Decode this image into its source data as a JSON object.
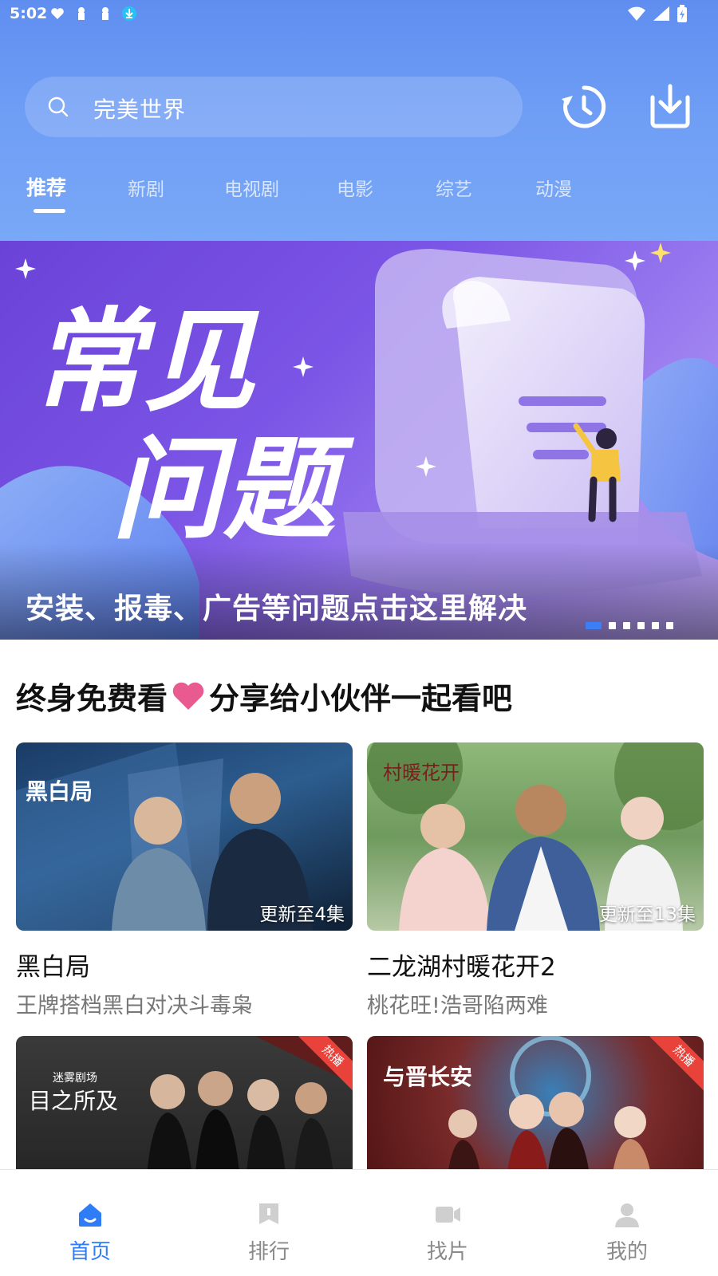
{
  "status_bar": {
    "time": "5:02"
  },
  "search": {
    "text": "完美世界"
  },
  "tabs": [
    {
      "label": "推荐",
      "active": true
    },
    {
      "label": "新剧",
      "active": false
    },
    {
      "label": "电视剧",
      "active": false
    },
    {
      "label": "电影",
      "active": false
    },
    {
      "label": "综艺",
      "active": false
    },
    {
      "label": "动漫",
      "active": false
    }
  ],
  "banner": {
    "headline_line1": "常见",
    "headline_line2": "问题",
    "caption": "安装、报毒、广告等问题点击这里解决",
    "slide_count": 6,
    "active_slide": 1
  },
  "section": {
    "title_left": "终身免费看",
    "title_right": "分享给小伙伴一起看吧"
  },
  "cards": [
    {
      "title": "黑白局",
      "desc": "王牌搭档黑白对决斗毒枭",
      "update": "更新至4集",
      "poster_text": "黑白局"
    },
    {
      "title": "二龙湖村暖花开2",
      "desc": "桃花旺!浩哥陷两难",
      "update": "更新至13集",
      "poster_text": "村暖花开"
    },
    {
      "title": "目之所及",
      "hot": "热播",
      "poster_text": "目之所及",
      "poster_brand": "迷雾剧场"
    },
    {
      "title": "与晋长安",
      "hot": "热播",
      "poster_text": "与晋长安"
    }
  ],
  "bottom_nav": [
    {
      "label": "首页",
      "icon": "home-icon",
      "active": true
    },
    {
      "label": "排行",
      "icon": "ranking-icon",
      "active": false
    },
    {
      "label": "找片",
      "icon": "video-camera-icon",
      "active": false
    },
    {
      "label": "我的",
      "icon": "user-icon",
      "active": false
    }
  ],
  "colors": {
    "header": "#6e9df5",
    "accent": "#2f7df6",
    "banner": "#7b55e6",
    "heart": "#e85a90",
    "hot": "#e8423a"
  }
}
